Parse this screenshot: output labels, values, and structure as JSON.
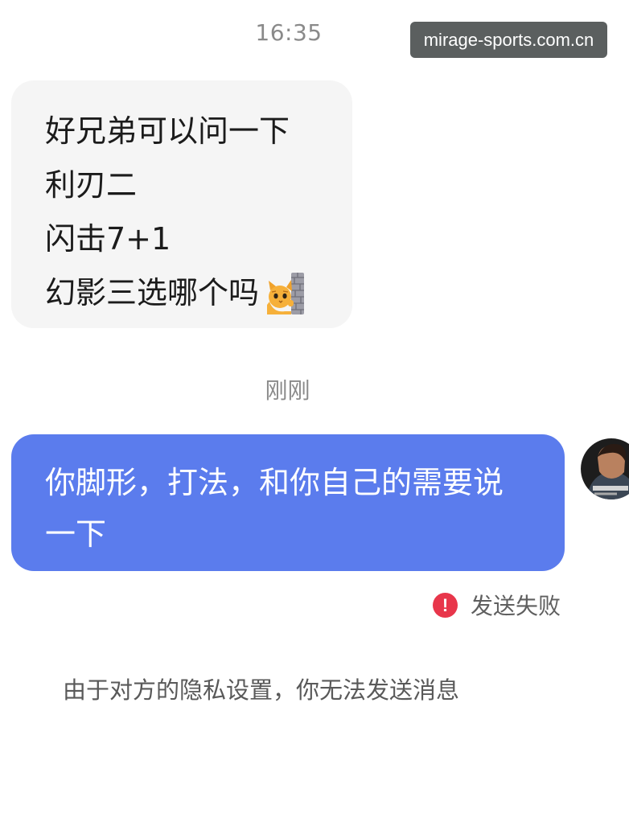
{
  "header": {
    "timestamp": "16:35",
    "watermark": "mirage-sports.com.cn"
  },
  "messages": {
    "incoming": {
      "lines": [
        "好兄弟可以问一下",
        "利刃二",
        "闪击7+1",
        "幻影三选哪个吗"
      ],
      "emoji": "cat-peeking-behind-wall"
    },
    "time_separator": "刚刚",
    "outgoing": {
      "text_line_1": "你脚形，打法，和你自己的需要说",
      "text_line_2": "一下",
      "status_icon": "!",
      "status": "发送失败"
    },
    "system_notice": "由于对方的隐私设置，你无法发送消息"
  },
  "colors": {
    "background": "#ffffff",
    "incoming_bubble": "#f5f5f5",
    "outgoing_bubble": "#5b7ced",
    "error": "#e8364b",
    "muted_text": "#8a8a8a"
  },
  "icons": {
    "avatar": "user-avatar",
    "status_error": "error-icon"
  }
}
